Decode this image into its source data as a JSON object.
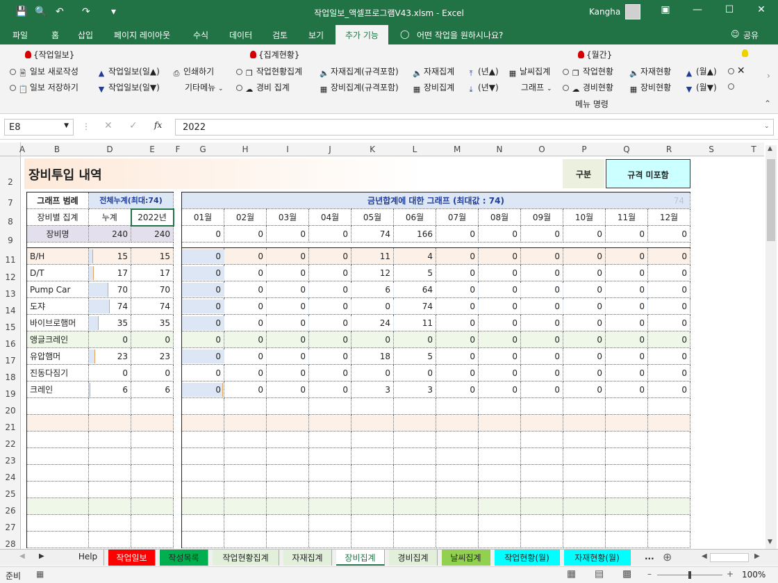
{
  "app": {
    "title": "작업일보_액셀프로그램V43.xlsm  -  Excel",
    "user": "Kangha"
  },
  "ribbon_tabs": [
    "파일",
    "홈",
    "삽입",
    "페이지 레이아웃",
    "수식",
    "데이터",
    "검토",
    "보기",
    "추가 기능"
  ],
  "tell_me": "어떤 작업을 원하시나요?",
  "share": "공유",
  "ribbon": {
    "group1_title": "{작업일보}",
    "group2_title": "{집계현황}",
    "group3_title": "{월간}",
    "b_new": "일보 새로작성",
    "b_save": "일보 저장하기",
    "b_up": "작업일보(일▲)",
    "b_down": "작업일보(일▼)",
    "b_print": "인쇄하기",
    "b_etc": "기타메뉴",
    "b_work": "작업현황집계",
    "b_cost": "경비 집계",
    "b_mat_spec": "자재집계(규격포함)",
    "b_eq_spec": "장비집계(규격포함)",
    "b_mat": "자재집계",
    "b_eq": "장비집계",
    "b_yup": "(년▲)",
    "b_ydn": "(년▼)",
    "b_weather": "날씨집계",
    "b_graph": "그래프",
    "b_mwork": "작업현황",
    "b_mcost": "경비현황",
    "b_mmat": "자재현황",
    "b_meq": "장비현황",
    "b_mup": "(월▲)",
    "b_mdn": "(월▼)",
    "menu_cmd": "메뉴 명령"
  },
  "namebox": "E8",
  "formula": "2022",
  "columns": [
    "A",
    "B",
    "D",
    "E",
    "F",
    "G",
    "H",
    "I",
    "J",
    "K",
    "L",
    "M",
    "N",
    "O",
    "P",
    "Q",
    "R",
    "S",
    "T"
  ],
  "rows": [
    "2",
    "7",
    "8",
    "9",
    "11",
    "12",
    "13",
    "14",
    "15",
    "16",
    "17",
    "18",
    "19",
    "20",
    "21",
    "22",
    "23",
    "24",
    "25",
    "26",
    "27",
    "28"
  ],
  "sheet": {
    "title": "장비투입 내역",
    "gubun_label": "구분",
    "gubun_value": "규격 미포함",
    "legend_label": "그래프 범례",
    "legend_value": "전체누계(최대:74)",
    "graph_title": "금년합계에 대한 그래프 (최대값 : 74)",
    "graph_max_faint": "74",
    "hdr_agg": "장비별 집계",
    "hdr_total": "누계",
    "hdr_year": "2022년",
    "hdr_name": "장비명",
    "sum_total": "240",
    "sum_year": "240",
    "months": [
      "01월",
      "02월",
      "03월",
      "04월",
      "05월",
      "06월",
      "07월",
      "08월",
      "09월",
      "10월",
      "11월",
      "12월"
    ],
    "month_totals": [
      "0",
      "0",
      "0",
      "0",
      "74",
      "166",
      "0",
      "0",
      "0",
      "0",
      "0",
      "0"
    ],
    "items": [
      {
        "name": "B/H",
        "total": "15",
        "year": "15",
        "m": [
          "0",
          "0",
          "0",
          "0",
          "11",
          "4",
          "0",
          "0",
          "0",
          "0",
          "0",
          "0"
        ]
      },
      {
        "name": "D/T",
        "total": "17",
        "year": "17",
        "m": [
          "0",
          "0",
          "0",
          "0",
          "12",
          "5",
          "0",
          "0",
          "0",
          "0",
          "0",
          "0"
        ]
      },
      {
        "name": "Pump Car",
        "total": "70",
        "year": "70",
        "m": [
          "0",
          "0",
          "0",
          "0",
          "6",
          "64",
          "0",
          "0",
          "0",
          "0",
          "0",
          "0"
        ]
      },
      {
        "name": "도쟈",
        "total": "74",
        "year": "74",
        "m": [
          "0",
          "0",
          "0",
          "0",
          "0",
          "74",
          "0",
          "0",
          "0",
          "0",
          "0",
          "0"
        ]
      },
      {
        "name": "바이브로햄머",
        "total": "35",
        "year": "35",
        "m": [
          "0",
          "0",
          "0",
          "0",
          "24",
          "11",
          "0",
          "0",
          "0",
          "0",
          "0",
          "0"
        ]
      },
      {
        "name": "앵글크레인",
        "total": "0",
        "year": "0",
        "m": [
          "0",
          "0",
          "0",
          "0",
          "0",
          "0",
          "0",
          "0",
          "0",
          "0",
          "0",
          "0"
        ]
      },
      {
        "name": "유압햄머",
        "total": "23",
        "year": "23",
        "m": [
          "0",
          "0",
          "0",
          "0",
          "18",
          "5",
          "0",
          "0",
          "0",
          "0",
          "0",
          "0"
        ]
      },
      {
        "name": "진동다짐기",
        "total": "0",
        "year": "0",
        "m": [
          "0",
          "0",
          "0",
          "0",
          "0",
          "0",
          "0",
          "0",
          "0",
          "0",
          "0",
          "0"
        ]
      },
      {
        "name": "크레인",
        "total": "6",
        "year": "6",
        "m": [
          "0",
          "0",
          "0",
          "0",
          "3",
          "3",
          "0",
          "0",
          "0",
          "0",
          "0",
          "0"
        ]
      }
    ],
    "bar_fractions": [
      0.203,
      0.23,
      0.946,
      1.0,
      0.473,
      0,
      0.311,
      0,
      0.081
    ]
  },
  "sheet_tabs": [
    {
      "label": "Help",
      "color": "#f0f0f0",
      "fg": "#222"
    },
    {
      "label": "작업일보",
      "color": "#ff0000",
      "fg": "#fff"
    },
    {
      "label": "작성목록",
      "color": "#00b050",
      "fg": "#222"
    },
    {
      "label": "작업현황집계",
      "color": "#e2efda",
      "fg": "#222"
    },
    {
      "label": "자재집계",
      "color": "#e2efda",
      "fg": "#222"
    },
    {
      "label": "장비집계",
      "color": "#ffffff",
      "fg": "#222"
    },
    {
      "label": "경비집계",
      "color": "#e2efda",
      "fg": "#222"
    },
    {
      "label": "날씨집계",
      "color": "#92d050",
      "fg": "#222"
    },
    {
      "label": "작업현황(월)",
      "color": "#00ffff",
      "fg": "#222"
    },
    {
      "label": "자재현황(월)",
      "color": "#00ffff",
      "fg": "#222"
    }
  ],
  "status": {
    "ready": "준비",
    "zoom": "100%"
  }
}
